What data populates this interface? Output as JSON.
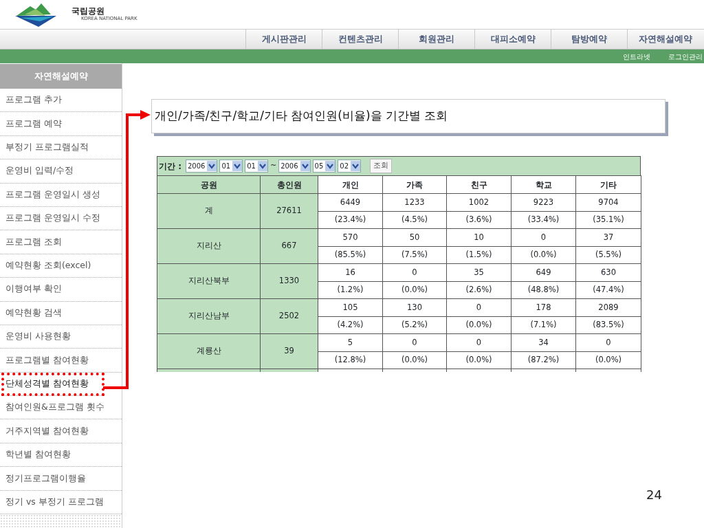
{
  "logo": {
    "title": "국립공원",
    "subtitle": "KOREA NATIONAL PARK"
  },
  "nav_menu": [
    {
      "label": "게시판관리"
    },
    {
      "label": "컨텐츠관리"
    },
    {
      "label": "회원관리"
    },
    {
      "label": "대피소예약"
    },
    {
      "label": "탐방예약"
    },
    {
      "label": "자연해설예약"
    }
  ],
  "utility_links": [
    "인트라넷",
    "로그인관리"
  ],
  "sidebar": {
    "title": "자연해설예약",
    "items": [
      {
        "label": "프로그램 추가",
        "highlighted": false
      },
      {
        "label": "프로그램 예약",
        "highlighted": false
      },
      {
        "label": "부정기 프로그램실적",
        "highlighted": false
      },
      {
        "label": "운영비 입력/수정",
        "highlighted": false
      },
      {
        "label": "프로그램 운영일시 생성",
        "highlighted": false
      },
      {
        "label": "프로그램 운영일시 수정",
        "highlighted": false
      },
      {
        "label": "프로그램 조회",
        "highlighted": false
      },
      {
        "label": "예약현황 조회(excel)",
        "highlighted": false
      },
      {
        "label": "이행여부 확인",
        "highlighted": false
      },
      {
        "label": "예약현황 검색",
        "highlighted": false
      },
      {
        "label": "운영비 사용현황",
        "highlighted": false
      },
      {
        "label": "프로그램별 참여현황",
        "highlighted": false
      },
      {
        "label": "단체성격별 참여현황",
        "highlighted": true
      },
      {
        "label": "참여인원&프로그램 횟수",
        "highlighted": false
      },
      {
        "label": "거주지역별 참여현황",
        "highlighted": false
      },
      {
        "label": "학년별 참여현황",
        "highlighted": false
      },
      {
        "label": "정기프로그램이행율",
        "highlighted": false
      },
      {
        "label": "정기 vs 부정기 프로그램",
        "highlighted": false
      }
    ]
  },
  "callout": "개인/가족/친구/학교/기타 참여인원(비율)을 기간별 조회",
  "filter": {
    "label": "기간 :",
    "start": [
      "2006",
      "01",
      "01"
    ],
    "separator": "~",
    "end": [
      "2006",
      "05",
      "02"
    ],
    "button": "조회"
  },
  "table": {
    "columns": [
      "공원",
      "총인원",
      "개인",
      "가족",
      "친구",
      "학교",
      "기타"
    ],
    "rows": [
      {
        "park": "계",
        "total": "27611",
        "counts": [
          "6449",
          "1233",
          "1002",
          "9223",
          "9704"
        ],
        "percents": [
          "(23.4%)",
          "(4.5%)",
          "(3.6%)",
          "(33.4%)",
          "(35.1%)"
        ]
      },
      {
        "park": "지리산",
        "total": "667",
        "counts": [
          "570",
          "50",
          "10",
          "0",
          "37"
        ],
        "percents": [
          "(85.5%)",
          "(7.5%)",
          "(1.5%)",
          "(0.0%)",
          "(5.5%)"
        ]
      },
      {
        "park": "지리산북부",
        "total": "1330",
        "counts": [
          "16",
          "0",
          "35",
          "649",
          "630"
        ],
        "percents": [
          "(1.2%)",
          "(0.0%)",
          "(2.6%)",
          "(48.8%)",
          "(47.4%)"
        ]
      },
      {
        "park": "지리산남부",
        "total": "2502",
        "counts": [
          "105",
          "130",
          "0",
          "178",
          "2089"
        ],
        "percents": [
          "(4.2%)",
          "(5.2%)",
          "(0.0%)",
          "(7.1%)",
          "(83.5%)"
        ]
      },
      {
        "park": "계룡산",
        "total": "39",
        "counts": [
          "5",
          "0",
          "0",
          "34",
          "0"
        ],
        "percents": [
          "(12.8%)",
          "(0.0%)",
          "(0.0%)",
          "(87.2%)",
          "(0.0%)"
        ]
      }
    ]
  },
  "page_number": "24"
}
